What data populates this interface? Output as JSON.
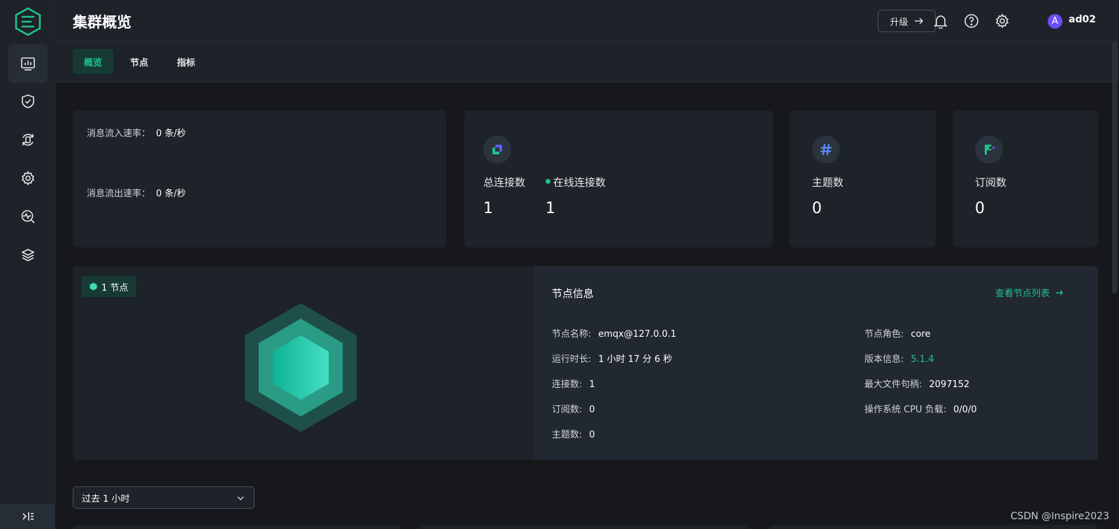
{
  "header": {
    "title": "集群概览",
    "upgrade_label": "升级",
    "username": "ad02",
    "avatar_initial": "A"
  },
  "tabs": [
    {
      "label": "概览",
      "active": true
    },
    {
      "label": "节点",
      "active": false
    },
    {
      "label": "指标",
      "active": false
    }
  ],
  "rates": {
    "in_label": "消息流入速率：",
    "in_value": "0 条/秒",
    "out_label": "消息流出速率：",
    "out_value": "0 条/秒"
  },
  "stats": {
    "total_connections_label": "总连接数",
    "total_connections_value": "1",
    "online_connections_label": "在线连接数",
    "online_connections_value": "1",
    "topics_label": "主题数",
    "topics_value": "0",
    "subscriptions_label": "订阅数",
    "subscriptions_value": "0"
  },
  "node": {
    "badge": "1 节点",
    "info_title": "节点信息",
    "view_list_link": "查看节点列表",
    "left": [
      {
        "label": "节点名称:",
        "value": "emqx@127.0.0.1"
      },
      {
        "label": "运行时长:",
        "value": "1 小时 17 分 6 秒"
      },
      {
        "label": "连接数:",
        "value": "1"
      },
      {
        "label": "订阅数:",
        "value": "0"
      },
      {
        "label": "主题数:",
        "value": "0"
      }
    ],
    "right": [
      {
        "label": "节点角色:",
        "value": "core"
      },
      {
        "label": "版本信息:",
        "value": "5.1.4"
      },
      {
        "label": "最大文件句柄:",
        "value": "2097152"
      },
      {
        "label": "操作系统 CPU 负载:",
        "value": "0/0/0"
      }
    ]
  },
  "time_range": {
    "selected": "过去 1 小时"
  },
  "watermark": "CSDN @Inspire2023",
  "colors": {
    "accent": "#1fc28e",
    "background": "#16181c",
    "card": "#1e2229"
  }
}
